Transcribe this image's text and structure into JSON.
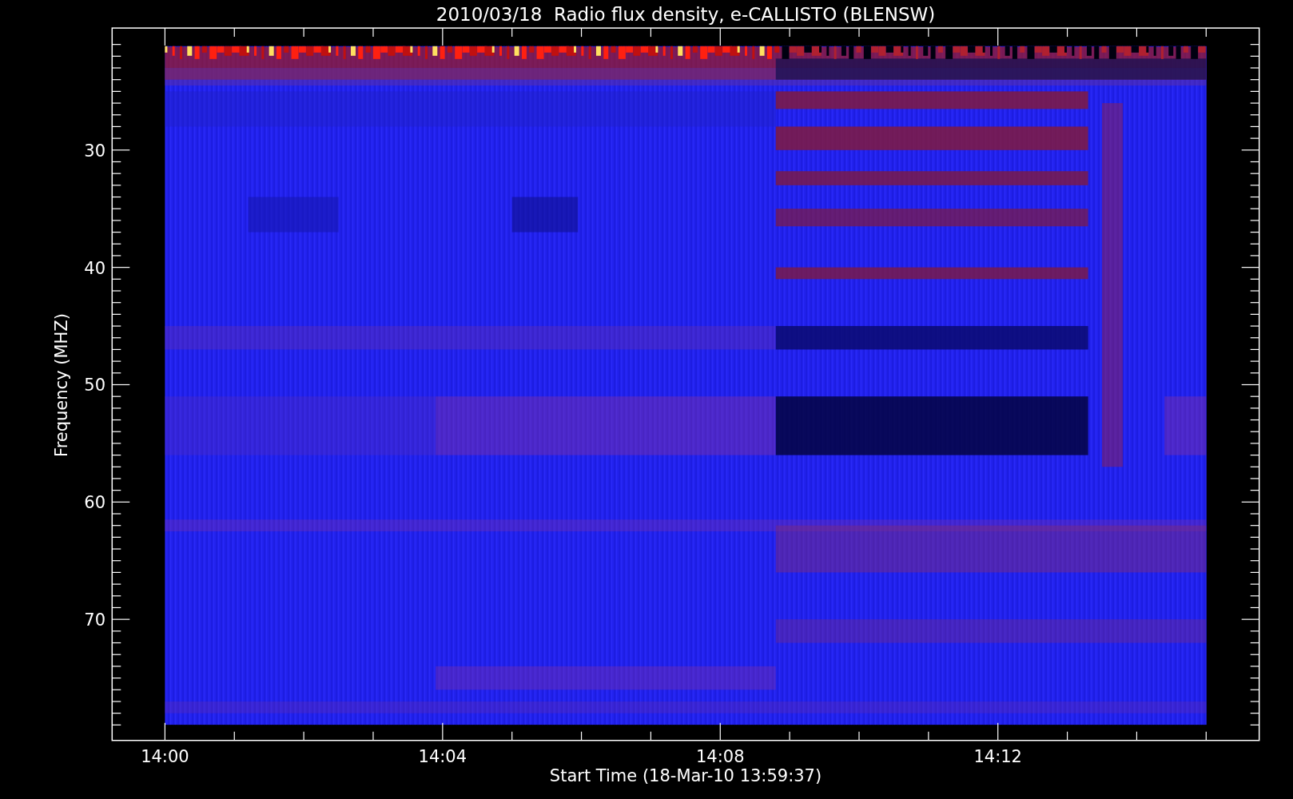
{
  "title": "2010/03/18  Radio flux density, e-CALLISTO (BLENSW)",
  "xlabel": "Start Time (18-Mar-10 13:59:37)",
  "ylabel": "Frequency (MHZ)",
  "xticks": [
    "14:00",
    "14:04",
    "14:08",
    "14:12"
  ],
  "yticks": [
    "30",
    "40",
    "50",
    "60",
    "70"
  ]
}
